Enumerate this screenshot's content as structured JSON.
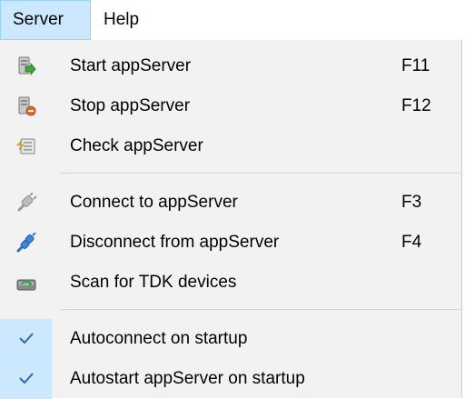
{
  "menubar": {
    "items": [
      {
        "label": "Server"
      },
      {
        "label": "Help"
      }
    ]
  },
  "menu": {
    "items": [
      {
        "label": "Start appServer",
        "shortcut": "F11",
        "icon": "server-start-icon"
      },
      {
        "label": "Stop appServer",
        "shortcut": "F12",
        "icon": "server-stop-icon"
      },
      {
        "label": "Check appServer",
        "shortcut": "",
        "icon": "server-check-icon"
      },
      {
        "label": "Connect to appServer",
        "shortcut": "F3",
        "icon": "plug-connect-icon"
      },
      {
        "label": "Disconnect from appServer",
        "shortcut": "F4",
        "icon": "plug-disconnect-icon"
      },
      {
        "label": "Scan for TDK devices",
        "shortcut": "",
        "icon": "scan-devices-icon"
      },
      {
        "label": "Autoconnect on startup",
        "checked": true
      },
      {
        "label": "Autostart appServer on startup",
        "checked": true
      }
    ]
  },
  "colors": {
    "highlight": "#cce8ff",
    "menu_bg": "#f2f2f2",
    "check": "#2b6cb0"
  }
}
